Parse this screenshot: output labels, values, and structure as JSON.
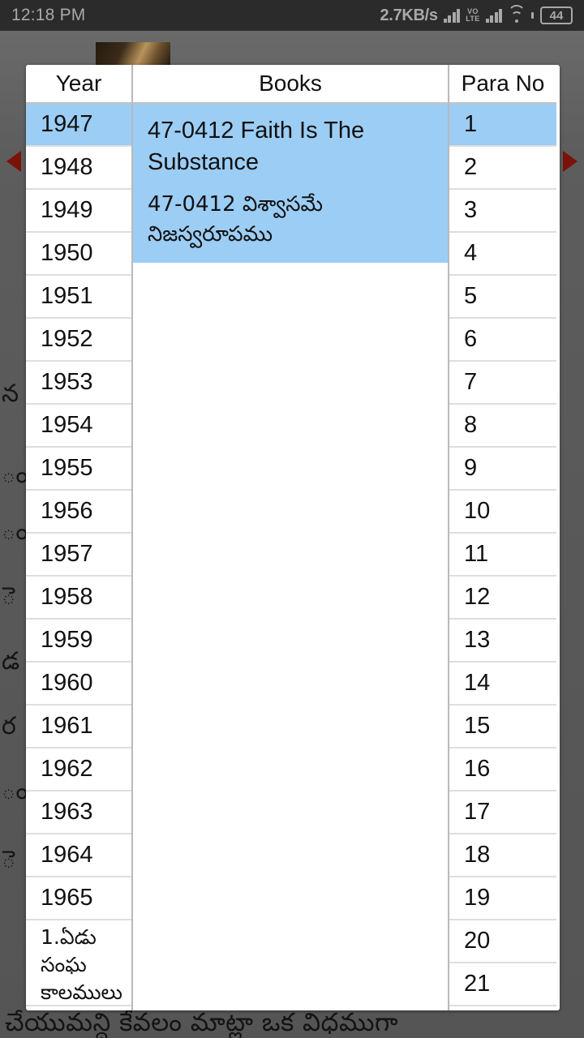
{
  "statusbar": {
    "time": "12:18 PM",
    "net_speed": "2.7KB/s",
    "volte_top": "VO",
    "volte_bottom": "LTE",
    "battery_level": "44",
    "icons": [
      "signal-bars-icon",
      "volte-icon",
      "signal-bars-icon",
      "wifi-icon",
      "battery-icon"
    ]
  },
  "background": {
    "telugu_fragments": [
      "న",
      "ం",
      "ం",
      "ె",
      "డ",
      "ర",
      "ం",
      "ె"
    ],
    "bottom_line": "చేయుమన్ది  కేవలం మాట్లా ఒక విధముగా",
    "prev_arrow": "previous-arrow",
    "next_arrow": "next-arrow"
  },
  "dialog": {
    "headers": {
      "year": "Year",
      "books": "Books",
      "para": "Para No"
    },
    "years": [
      "1947",
      "1948",
      "1949",
      "1950",
      "1951",
      "1952",
      "1953",
      "1954",
      "1955",
      "1956",
      "1957",
      "1958",
      "1959",
      "1960",
      "1961",
      "1962",
      "1963",
      "1964",
      "1965"
    ],
    "year_extra": "1.ఏడు సంఘ కాలములు",
    "selected_year": "1947",
    "book_selected": {
      "english": "47-0412 Faith Is The Substance",
      "telugu": "47-0412 విశ్వాసమే నిజస్వరూపము"
    },
    "paras": [
      "1",
      "2",
      "3",
      "4",
      "5",
      "6",
      "7",
      "8",
      "9",
      "10",
      "11",
      "12",
      "13",
      "14",
      "15",
      "16",
      "17",
      "18",
      "19",
      "20",
      "21"
    ],
    "selected_para": "1",
    "colors": {
      "highlight": "#9ccdf5",
      "dialog_bg": "#ffffff",
      "scrim": "#5a5a5a",
      "statusbar_bg": "#2b2b2b",
      "arrow": "#7a1208"
    }
  }
}
